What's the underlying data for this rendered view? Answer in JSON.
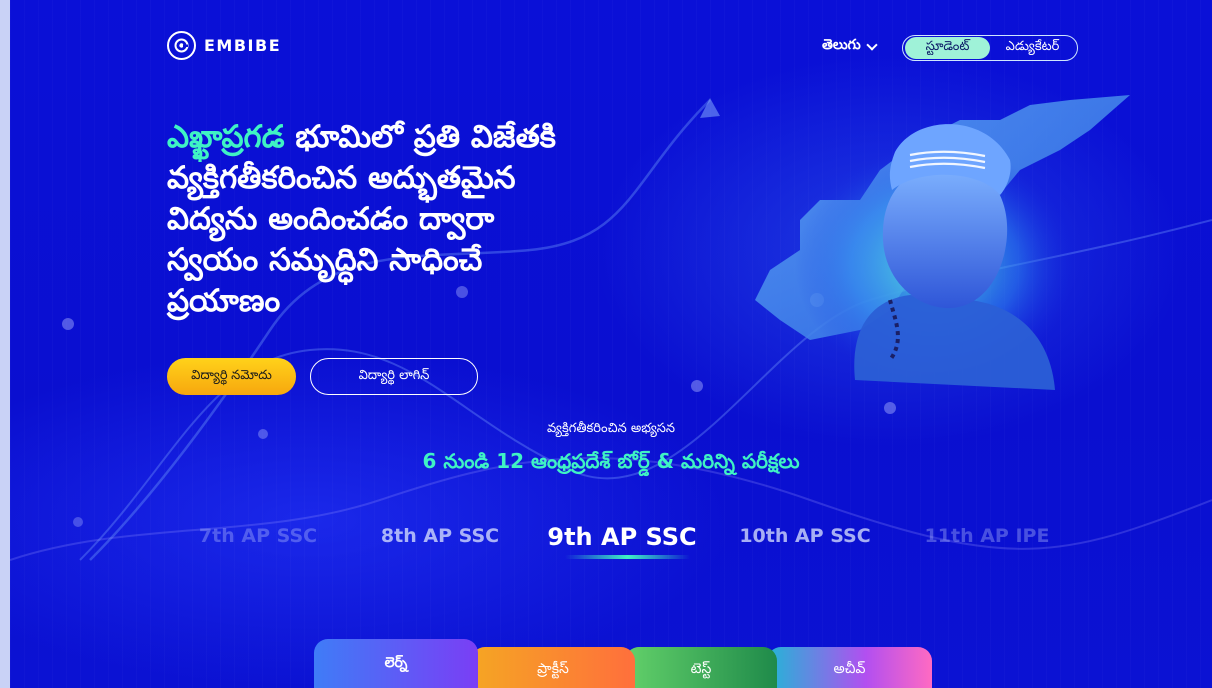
{
  "brand": {
    "name": "EMBIBE"
  },
  "header": {
    "language": "తెలుగు",
    "toggle": {
      "student": "స్టూడెంట్",
      "educator": "ఎడ్యుకేటర్",
      "active": "student"
    }
  },
  "hero": {
    "accent": "ఎఖ్ఖాప్రగడ",
    "line1_rest": " భూమిలో ప్రతి విజేతకి",
    "line2": "వ్యక్తిగతీకరించిన అద్భుతమైన",
    "line3": "విద్యను అందించడం ద్వారా",
    "line4": "స్వయం సమృద్ధిని సాధించే",
    "line5": "ప్రయాణం"
  },
  "buttons": {
    "register": "విద్యార్థి నమోదు",
    "login": "విద్యార్థి లాగిన్"
  },
  "subheading": {
    "line1": "వ్యక్తిగతీకరించిన అభ్యసన",
    "line2": "6 నుండి 12 ఆంధ్రప్రదేశ్ బోర్డ్ & మరిన్ని పరీక్షలు"
  },
  "grades": [
    "7th AP SSC",
    "8th AP SSC",
    "9th AP SSC",
    "10th AP SSC",
    "11th AP IPE"
  ],
  "grades_selected_index": 2,
  "tabs": [
    "లెర్న్",
    "ప్రాక్టీస్",
    "టెస్ట్",
    "అచీవ్"
  ],
  "colors": {
    "background": "#0b0fd6",
    "accent": "#3ff3c4",
    "cta": "#ffc414",
    "left_strip": "#c9d2f6"
  },
  "icons": [
    "embibe-logo-icon",
    "chevron-down-icon"
  ]
}
